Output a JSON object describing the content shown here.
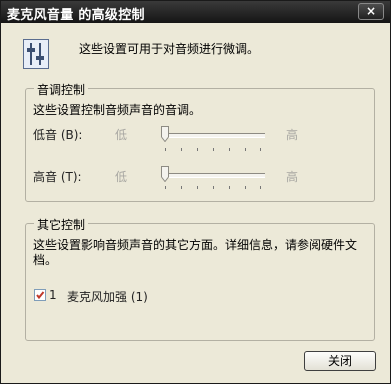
{
  "window": {
    "title": "麦克风音量 的高级控制",
    "close_symbol": "×"
  },
  "header": {
    "icon": "mixer-settings-icon",
    "text": "这些设置可用于对音频进行微调。"
  },
  "tone_group": {
    "title": "音调控制",
    "description": "这些设置控制音频声音的音调。",
    "bass": {
      "label": "低音 (B):",
      "low": "低",
      "high": "高",
      "value": 0
    },
    "treble": {
      "label": "高音 (T):",
      "low": "低",
      "high": "高",
      "value": 0
    }
  },
  "other_group": {
    "title": "其它控制",
    "description": "这些设置影响音频声音的其它方面。详细信息，请参阅硬件文档。",
    "checkbox": {
      "number": "1",
      "label": "麦克风加强 (1)",
      "checked": true
    }
  },
  "buttons": {
    "close_label": "关闭"
  },
  "colors": {
    "title_bar": "#1f1f1f",
    "dialog_bg": "#ece9d8"
  }
}
